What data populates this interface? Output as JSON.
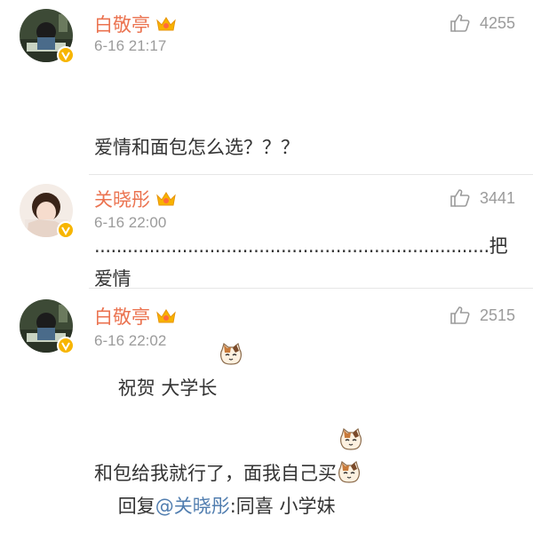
{
  "comments": [
    {
      "username": "白敬亭",
      "timestamp": "6-16 21:17",
      "likes": "4255",
      "text_line1": "爱情和面包怎么选？？？",
      "text_line2": "........................................................................把爱情",
      "text_line3": "和包给我就行了，面我自己买",
      "emoji": "cat-face-emoji"
    },
    {
      "username": "关晓彤",
      "timestamp": "6-16 22:00",
      "likes": "3441",
      "text_line1": "祝贺 大学长",
      "emoji": "cat-face-emoji"
    },
    {
      "username": "白敬亭",
      "timestamp": "6-16 22:02",
      "likes": "2515",
      "reply_prefix": "回复",
      "mention": "@关晓彤",
      "reply_text": ":同喜 小学妹",
      "emoji": "cat-face-emoji"
    }
  ],
  "colors": {
    "username": "#eb7350",
    "mention": "#507daf",
    "meta": "#9b9b9b",
    "verified_badge": "#f7b500"
  }
}
